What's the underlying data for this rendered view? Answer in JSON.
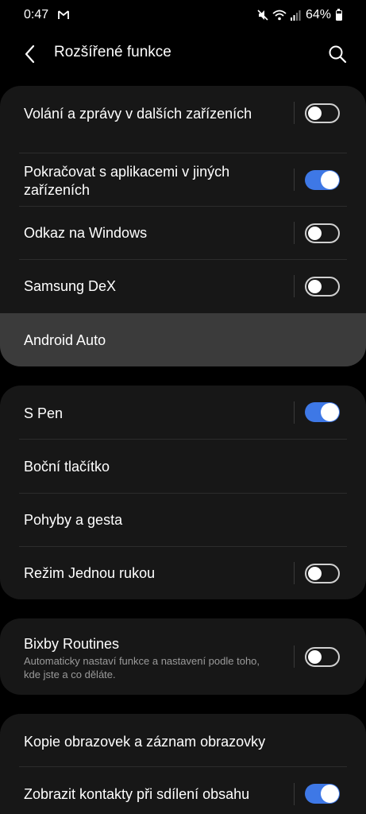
{
  "status_bar": {
    "time": "0:47",
    "battery": "64%",
    "left_icon": "gmail-icon",
    "right_icons": [
      "mute-icon",
      "wifi-icon",
      "signal-icon",
      "battery-icon"
    ]
  },
  "header": {
    "title": "Rozšířené funkce",
    "back_icon": "back-chevron-icon",
    "search_icon": "search-icon"
  },
  "colors": {
    "background": "#000000",
    "card": "#171717",
    "highlight": "#3b3b3b",
    "toggle_on": "#3e78e6"
  },
  "sections": [
    {
      "items": [
        {
          "label": "Volání a zprávy v dalších zařízeních",
          "toggle": "off"
        },
        {
          "label_line1": "Pokračovat s aplikacemi v jiných",
          "label_line2": "zařízeních",
          "toggle": "on"
        },
        {
          "label": "Odkaz na Windows",
          "toggle": "off"
        },
        {
          "label": "Samsung DeX",
          "toggle": "off"
        },
        {
          "label": "Android Auto",
          "state": "pressed"
        }
      ]
    },
    {
      "items": [
        {
          "label": "S Pen",
          "toggle": "on"
        },
        {
          "label": "Boční tlačítko"
        },
        {
          "label": "Pohyby a gesta"
        },
        {
          "label": "Režim Jednou rukou",
          "toggle": "off"
        }
      ]
    },
    {
      "items": [
        {
          "label": "Bixby Routines",
          "sublabel_line1": "Automaticky nastaví funkce a nastavení podle toho,",
          "sublabel_line2": "kde jste a co děláte.",
          "toggle": "off"
        }
      ]
    },
    {
      "items": [
        {
          "label": "Kopie obrazovek a záznam obrazovky"
        },
        {
          "label": "Zobrazit kontakty při sdílení obsahu",
          "toggle": "on"
        }
      ]
    }
  ]
}
